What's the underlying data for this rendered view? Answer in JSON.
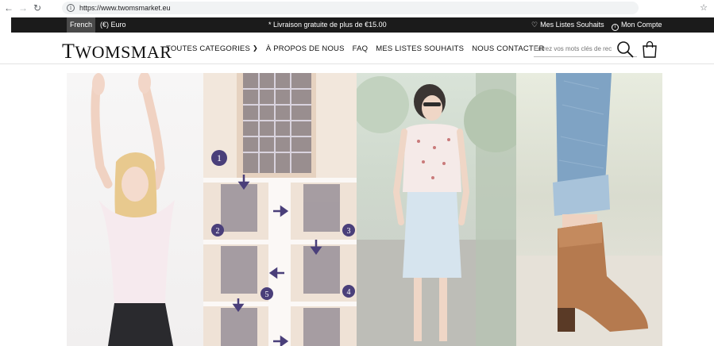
{
  "browser": {
    "url": "https://www.twomsmarket.eu"
  },
  "topbar": {
    "language": "French",
    "currency": "(€) Euro",
    "promo": "* Livraison gratuite de plus de €15.00",
    "wishlist": "Mes Listes Souhaits",
    "account": "Mon Compte"
  },
  "header": {
    "logo_first": "T",
    "logo_rest": "WOMSMAR",
    "menu": [
      {
        "label": "TOUTES CATEGORIES"
      },
      {
        "label": "À PROPOS DE NOUS"
      },
      {
        "label": "FAQ"
      },
      {
        "label": "MES LISTES SOUHAITS"
      },
      {
        "label": "NOUS CONTACTER"
      }
    ],
    "search_placeholder": "Entrez vos mots clés de rec"
  },
  "hero": {
    "steps": [
      "1",
      "2",
      "3",
      "4",
      "5"
    ]
  },
  "colors": {
    "topbar_bg": "#1b1b1b",
    "language_bg": "#4a4a4a",
    "step_badge": "#4a3f7a"
  }
}
